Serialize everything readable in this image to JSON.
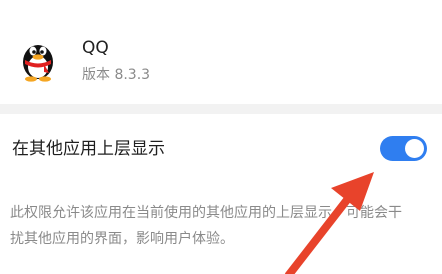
{
  "app": {
    "name": "QQ",
    "version": "版本 8.3.3",
    "icon": "qq-penguin-icon"
  },
  "setting": {
    "title": "在其他应用上层显示",
    "toggle_state": "on",
    "description": "此权限允许该应用在当前使用的其他应用的上层显示，可能会干扰其他应用的界面，影响用户体验。"
  },
  "colors": {
    "toggle_on": "#2f7ef0",
    "arrow": "#e8432b",
    "section_gap": "#f2f2f2"
  }
}
